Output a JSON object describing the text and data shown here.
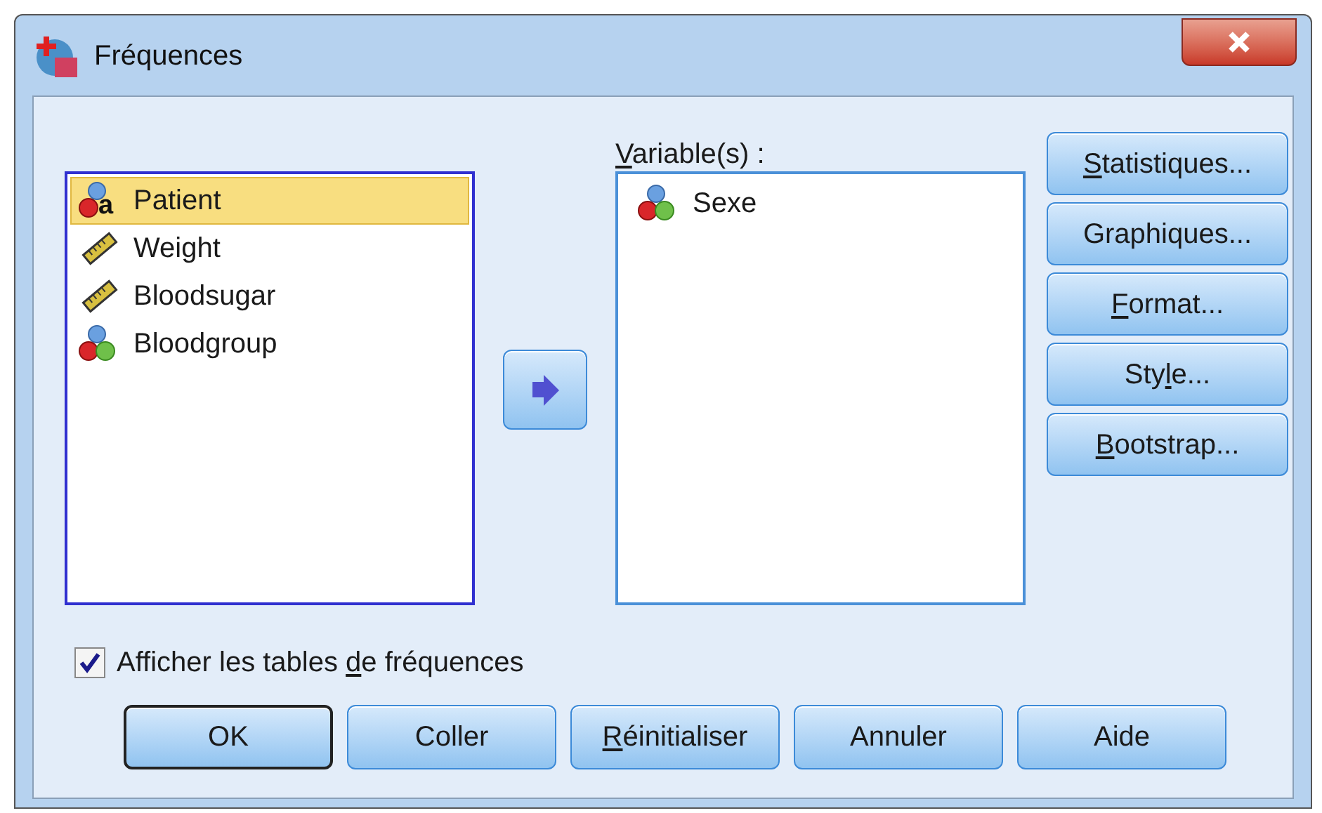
{
  "window": {
    "title": "Fréquences"
  },
  "source_list": {
    "items": [
      {
        "label": "Patient",
        "kind": "string",
        "icon_letter": "a",
        "selected": true
      },
      {
        "label": "Weight",
        "kind": "scale",
        "selected": false
      },
      {
        "label": "Bloodsugar",
        "kind": "scale",
        "selected": false
      },
      {
        "label": "Bloodgroup",
        "kind": "nominal",
        "selected": false
      }
    ]
  },
  "target_list": {
    "label": [
      {
        "text": "V",
        "underlined": true
      },
      {
        "text": "ariable(s) :",
        "underlined": false
      }
    ],
    "items": [
      {
        "label": "Sexe",
        "kind": "nominal",
        "selected": false
      }
    ]
  },
  "side_buttons": [
    {
      "label": [
        {
          "text": "S",
          "underlined": true
        },
        {
          "text": "tatistiques...",
          "underlined": false
        }
      ]
    },
    {
      "label": [
        {
          "text": "Graphiques...",
          "underlined": false
        }
      ]
    },
    {
      "label": [
        {
          "text": "F",
          "underlined": true
        },
        {
          "text": "ormat...",
          "underlined": false
        }
      ]
    },
    {
      "label": [
        {
          "text": "Sty",
          "underlined": false
        },
        {
          "text": "l",
          "underlined": true
        },
        {
          "text": "e...",
          "underlined": false
        }
      ]
    },
    {
      "label": [
        {
          "text": "B",
          "underlined": true
        },
        {
          "text": "ootstrap...",
          "underlined": false
        }
      ]
    }
  ],
  "checkbox": {
    "label": [
      {
        "text": "Afficher les tables ",
        "underlined": false
      },
      {
        "text": "d",
        "underlined": true
      },
      {
        "text": "e fréquences",
        "underlined": false
      }
    ],
    "checked": true
  },
  "buttons": [
    {
      "label": [
        {
          "text": "OK",
          "underlined": false
        }
      ],
      "default": true
    },
    {
      "label": [
        {
          "text": "Coller",
          "underlined": false
        }
      ],
      "default": false
    },
    {
      "label": [
        {
          "text": "R",
          "underlined": true
        },
        {
          "text": "éinitialiser",
          "underlined": false
        }
      ],
      "default": false
    },
    {
      "label": [
        {
          "text": "Annuler",
          "underlined": false
        }
      ],
      "default": false
    },
    {
      "label": [
        {
          "text": "Aide",
          "underlined": false
        }
      ],
      "default": false
    }
  ]
}
